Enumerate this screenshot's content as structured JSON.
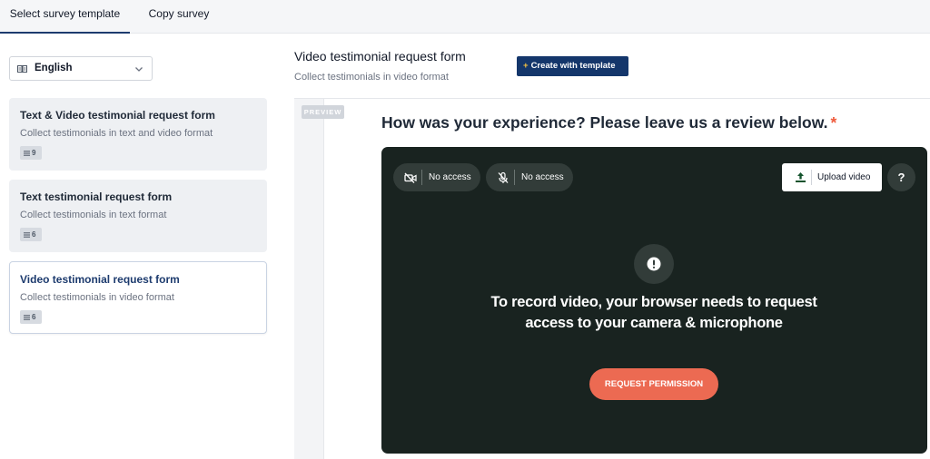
{
  "tabs": [
    {
      "label": "Select survey template",
      "active": true
    },
    {
      "label": "Copy survey",
      "active": false
    }
  ],
  "language": {
    "selected": "English",
    "icon": "language-icon"
  },
  "templates": [
    {
      "title": "Text & Video testimonial request form",
      "subtitle": "Collect testimonials in text and video format",
      "count": "9",
      "selected": false
    },
    {
      "title": "Text testimonial request form",
      "subtitle": "Collect testimonials in text format",
      "count": "6",
      "selected": false
    },
    {
      "title": "Video testimonial request form",
      "subtitle": "Collect testimonials in video format",
      "count": "6",
      "selected": true
    }
  ],
  "detail": {
    "title": "Video testimonial request form",
    "subtitle": "Collect testimonials in video format",
    "create_button": "Create with template"
  },
  "preview": {
    "tag": "PREVIEW",
    "question": "How was your experience? Please leave us a review below.",
    "required_mark": "*",
    "camera_status": "No access",
    "mic_status": "No access",
    "upload_label": "Upload video",
    "help_label": "?",
    "message": "To record video, your browser needs to request access to your camera & microphone",
    "permission_button": "REQUEST PERMISSION"
  },
  "colors": {
    "primary": "#14366b",
    "accent": "#ec6a52",
    "video_bg": "#192320",
    "required": "#ef5b3c"
  }
}
